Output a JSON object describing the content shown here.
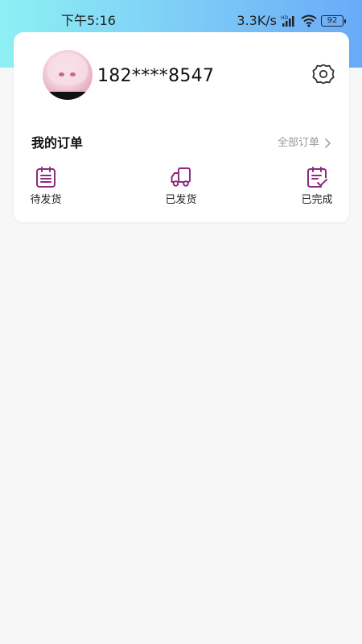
{
  "status_bar": {
    "time": "下午5:16",
    "net_speed": "3.3K/s",
    "battery": "92"
  },
  "profile": {
    "phone": "182****8547"
  },
  "orders": {
    "title": "我的订单",
    "all_label": "全部订单",
    "items": [
      {
        "label": "待发货",
        "icon": "clipboard-list-icon"
      },
      {
        "label": "已发货",
        "icon": "delivery-truck-icon"
      },
      {
        "label": "已完成",
        "icon": "clipboard-check-icon"
      }
    ]
  },
  "colors": {
    "accent": "#8e2a7c",
    "header_gradient_start": "#8ef0f4",
    "header_gradient_end": "#6aaaf8",
    "page_bg": "#f7f7f7"
  }
}
